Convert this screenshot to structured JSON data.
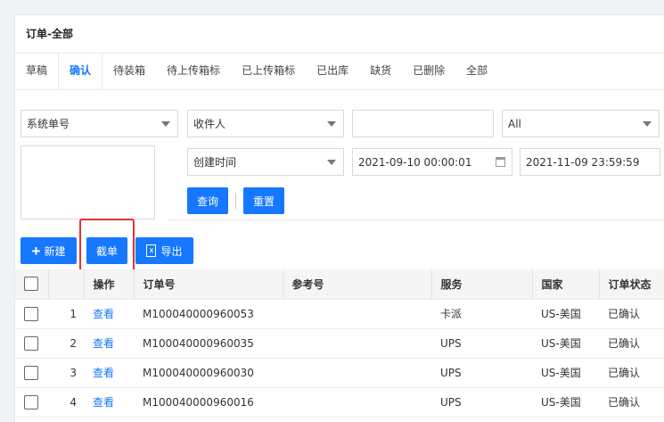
{
  "page": {
    "title": "订单-全部"
  },
  "tabs": [
    {
      "label": "草稿"
    },
    {
      "label": "确认"
    },
    {
      "label": "待装箱"
    },
    {
      "label": "待上传箱标"
    },
    {
      "label": "已上传箱标"
    },
    {
      "label": "已出库"
    },
    {
      "label": "缺货"
    },
    {
      "label": "已删除"
    },
    {
      "label": "全部"
    }
  ],
  "active_tab": "确认",
  "filters": {
    "order_field": "系统单号",
    "recipient_field": "收件人",
    "recipient_value": "",
    "status_select": "All",
    "date_field": "创建时间",
    "date_start": "2021-09-10 00:00:01",
    "date_end": "2021-11-09 23:59:59",
    "order_numbers": "",
    "query_label": "查询",
    "reset_label": "重置"
  },
  "toolbar": {
    "new_label": "新建",
    "cut_label": "截单",
    "export_label": "导出"
  },
  "table": {
    "columns": [
      "操作",
      "订单号",
      "参考号",
      "服务",
      "国家",
      "订单状态"
    ],
    "rows": [
      {
        "index": "1",
        "action": "查看",
        "order_no": "M100040000960053",
        "ref": "",
        "service": "卡派",
        "country": "US-美国",
        "status": "已确认"
      },
      {
        "index": "2",
        "action": "查看",
        "order_no": "M100040000960035",
        "ref": "",
        "service": "UPS",
        "country": "US-美国",
        "status": "已确认"
      },
      {
        "index": "3",
        "action": "查看",
        "order_no": "M100040000960030",
        "ref": "",
        "service": "UPS",
        "country": "US-美国",
        "status": "已确认"
      },
      {
        "index": "4",
        "action": "查看",
        "order_no": "M100040000960016",
        "ref": "",
        "service": "UPS",
        "country": "US-美国",
        "status": "已确认"
      }
    ]
  },
  "colors": {
    "primary": "#1677ff",
    "highlight": "#e8312f"
  }
}
